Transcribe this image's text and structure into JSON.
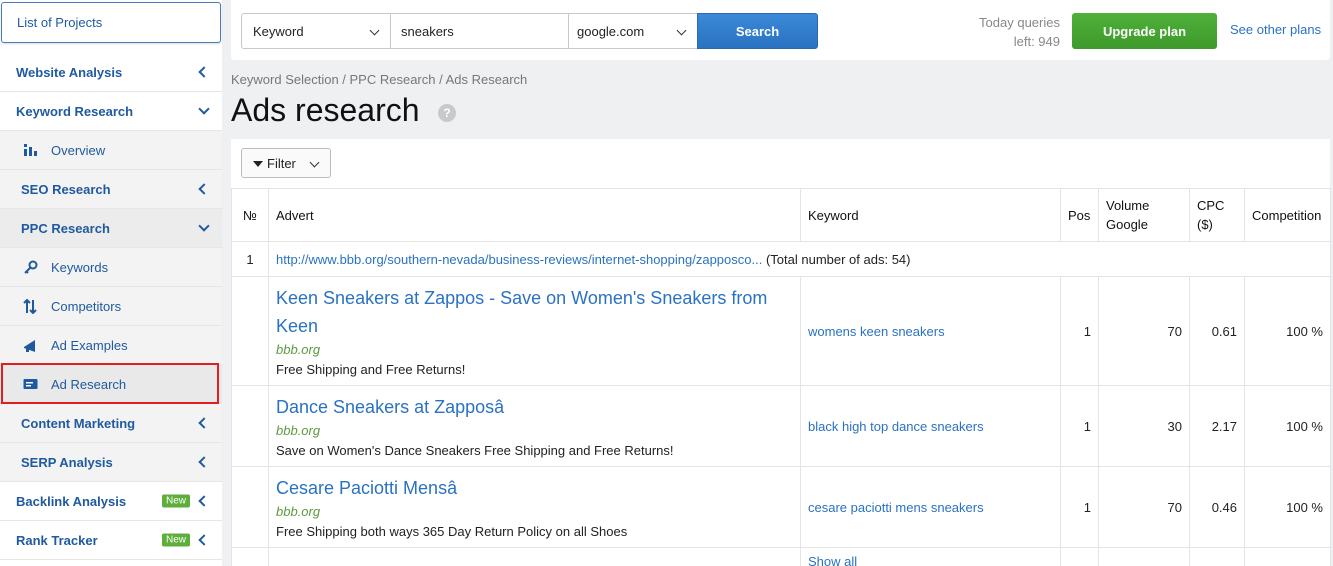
{
  "sidebar": {
    "projects_label": "List of Projects",
    "items": [
      {
        "label": "Website Analysis"
      },
      {
        "label": "Keyword Research"
      },
      {
        "label": "Overview"
      },
      {
        "label": "SEO Research"
      },
      {
        "label": "PPC Research"
      },
      {
        "label": "Keywords"
      },
      {
        "label": "Competitors"
      },
      {
        "label": "Ad Examples"
      },
      {
        "label": "Ad Research"
      },
      {
        "label": "Content Marketing"
      },
      {
        "label": "SERP Analysis"
      },
      {
        "label": "Backlink Analysis",
        "badge": "New"
      },
      {
        "label": "Rank Tracker",
        "badge": "New"
      }
    ]
  },
  "topbar": {
    "search_type": "Keyword",
    "keyword_value": "sneakers",
    "database": "google.com",
    "search_label": "Search",
    "queries_line1": "Today queries",
    "queries_line2": "left: 949",
    "upgrade_label": "Upgrade plan",
    "other_plans_label": "See other plans"
  },
  "breadcrumb": "Keyword Selection / PPC Research / Ads Research",
  "page_title": "Ads research",
  "help_glyph": "?",
  "filter_label": "Filter",
  "table": {
    "headers": {
      "num": "№",
      "advert": "Advert",
      "keyword": "Keyword",
      "pos": "Pos",
      "volume": "Volume Google",
      "cpc": "CPC ($)",
      "competition": "Competition"
    },
    "group": {
      "num": "1",
      "url": "http://www.bbb.org/southern-nevada/business-reviews/internet-shopping/zapposco...",
      "total": "(Total number of ads: 54)"
    },
    "rows": [
      {
        "title": "Keen Sneakers at Zappos - Save on Women's Sneakers from Keen",
        "domain": "bbb.org",
        "desc": "Free Shipping and Free Returns!",
        "keyword": "womens keen sneakers",
        "pos": "1",
        "volume": "70",
        "cpc": "0.61",
        "competition": "100 %"
      },
      {
        "title": "Dance Sneakers at Zapposâ",
        "domain": "bbb.org",
        "desc": "Save on Women's Dance Sneakers Free Shipping and Free Returns!",
        "keyword": "black high top dance sneakers",
        "pos": "1",
        "volume": "30",
        "cpc": "2.17",
        "competition": "100 %"
      },
      {
        "title": "Cesare Paciotti Mensâ",
        "domain": "bbb.org",
        "desc": "Free Shipping both ways 365 Day Return Policy on all Shoes",
        "keyword": "cesare paciotti mens sneakers",
        "pos": "1",
        "volume": "70",
        "cpc": "0.46",
        "competition": "100 %"
      }
    ],
    "show_all": "Show all"
  }
}
